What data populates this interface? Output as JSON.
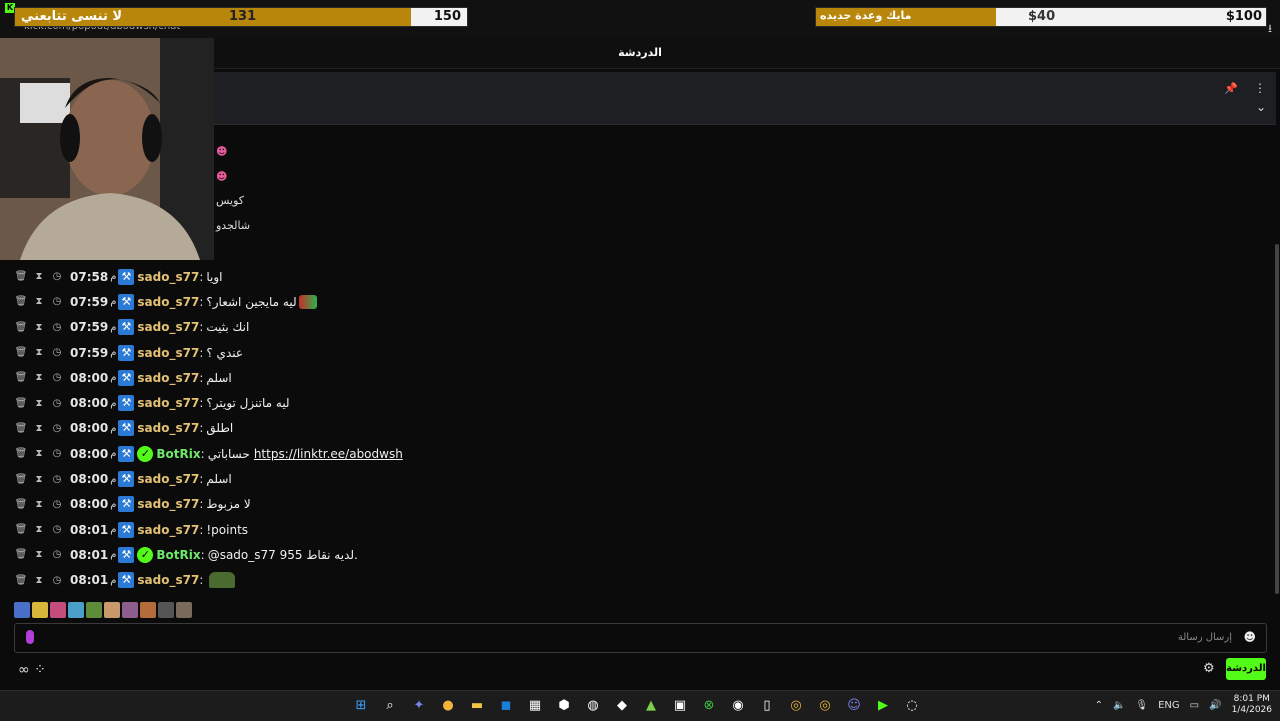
{
  "overlay": {
    "goal_left_text": "لا تنسى تتابعني",
    "goal_left_current": "131",
    "goal_left_target": "150",
    "goal_right_text": "مايك وعدة جديده",
    "goal_right_current": "$40",
    "goal_right_target": "$100",
    "url": "kick.com/popout/abodwsh/chat"
  },
  "chat": {
    "title": "الدردشة",
    "partial_lines": [
      "كويس",
      "شالجدو"
    ],
    "messages": [
      {
        "time": "07:58",
        "ampm": "م",
        "user": "sado_s77",
        "bot": false,
        "text": "اويا"
      },
      {
        "time": "07:59",
        "ampm": "م",
        "user": "sado_s77",
        "bot": false,
        "text": "ليه مايجين اشعار؟"
      },
      {
        "time": "07:59",
        "ampm": "م",
        "user": "sado_s77",
        "bot": false,
        "text": "انك بثيت"
      },
      {
        "time": "07:59",
        "ampm": "م",
        "user": "sado_s77",
        "bot": false,
        "text": "عندي ؟"
      },
      {
        "time": "08:00",
        "ampm": "م",
        "user": "sado_s77",
        "bot": false,
        "text": "اسلم"
      },
      {
        "time": "08:00",
        "ampm": "م",
        "user": "sado_s77",
        "bot": false,
        "text": "ليه ماتنزل تويتر؟"
      },
      {
        "time": "08:00",
        "ampm": "م",
        "user": "sado_s77",
        "bot": false,
        "text": "اطلق"
      },
      {
        "time": "08:00",
        "ampm": "م",
        "user": "BotRix",
        "bot": true,
        "text": "حساباتي",
        "link": "https://linktr.ee/abodwsh"
      },
      {
        "time": "08:00",
        "ampm": "م",
        "user": "sado_s77",
        "bot": false,
        "text": "اسلم"
      },
      {
        "time": "08:00",
        "ampm": "م",
        "user": "sado_s77",
        "bot": false,
        "text": "لا مزبوط"
      },
      {
        "time": "08:01",
        "ampm": "م",
        "user": "sado_s77",
        "bot": false,
        "text": "!points"
      },
      {
        "time": "08:01",
        "ampm": "م",
        "user": "BotRix",
        "bot": true,
        "text": "@sado_s77 955 لديه نقاط."
      },
      {
        "time": "08:01",
        "ampm": "م",
        "user": "sado_s77",
        "bot": false,
        "text": ""
      }
    ],
    "input_placeholder": "إرسال رسالة",
    "send_label": "الدردشة"
  },
  "taskbar": {
    "lang": "ENG",
    "time": "8:01 PM",
    "date": "1/4/2026"
  },
  "colors": {
    "accent": "#53fc18",
    "goal_fill": "#b8860b",
    "username": "#e3c173"
  }
}
